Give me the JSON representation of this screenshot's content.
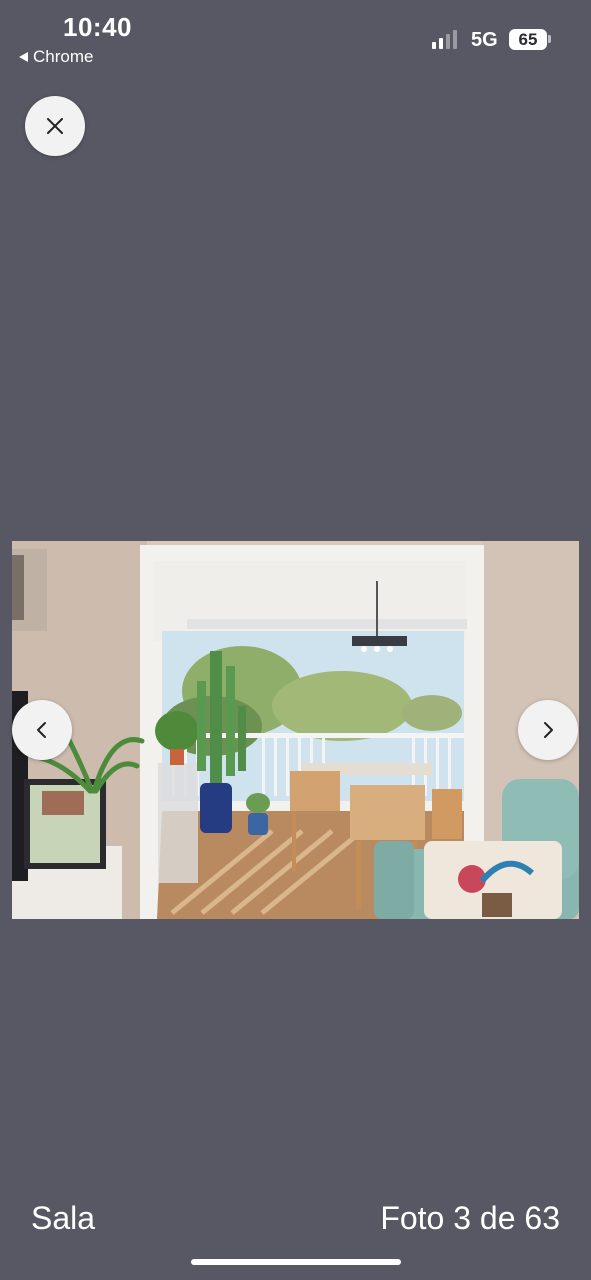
{
  "status_bar": {
    "time": "10:40",
    "back_app": "Chrome",
    "network": "5G",
    "battery": "65",
    "signal_bars_active": 2,
    "signal_bars_total": 4
  },
  "viewer": {
    "close_icon": "close-icon",
    "prev_icon": "chevron-left-icon",
    "next_icon": "chevron-right-icon",
    "photo_alt": "Sala"
  },
  "footer": {
    "caption": "Sala",
    "counter": "Foto 3 de 63"
  },
  "colors": {
    "background": "#585864",
    "button_bg": "#f2f2f2",
    "text": "#ffffff"
  }
}
